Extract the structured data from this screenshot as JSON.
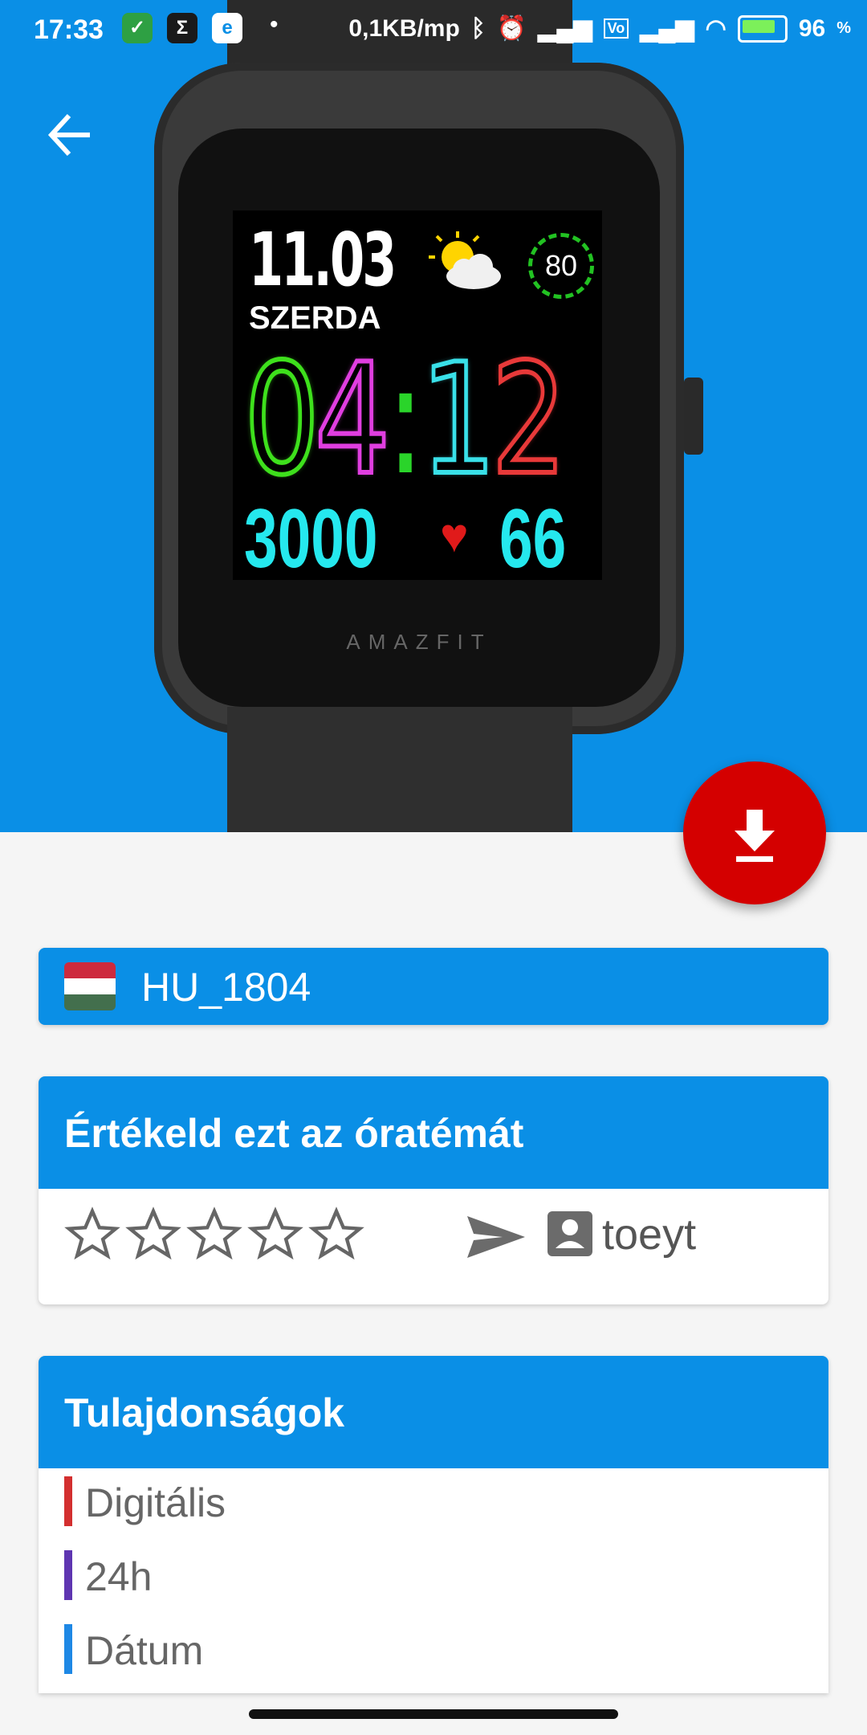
{
  "status_bar": {
    "time": "17:33",
    "network_speed": "0,1KB/mp",
    "battery": "96",
    "battery_unit": "%"
  },
  "watch_face": {
    "date": "11.03",
    "day": "SZERDA",
    "battery_level": "80",
    "hour": "04",
    "minute": "12",
    "steps": "3000",
    "heart_rate": "66",
    "brand": "AMAZFIT"
  },
  "title": {
    "name": "HU_1804",
    "flag": "hungary-flag"
  },
  "rating": {
    "heading": "Értékeld ezt az óratémát",
    "stars": 5,
    "author": "toeyt"
  },
  "properties": {
    "heading": "Tulajdonságok",
    "items": [
      {
        "label": "Digitális",
        "color": "#d32f2f"
      },
      {
        "label": "24h",
        "color": "#5e35b1"
      },
      {
        "label": "Dátum",
        "color": "#1e88e5"
      }
    ]
  },
  "colors": {
    "primary": "#0a8fe6",
    "fab": "#d40000"
  }
}
